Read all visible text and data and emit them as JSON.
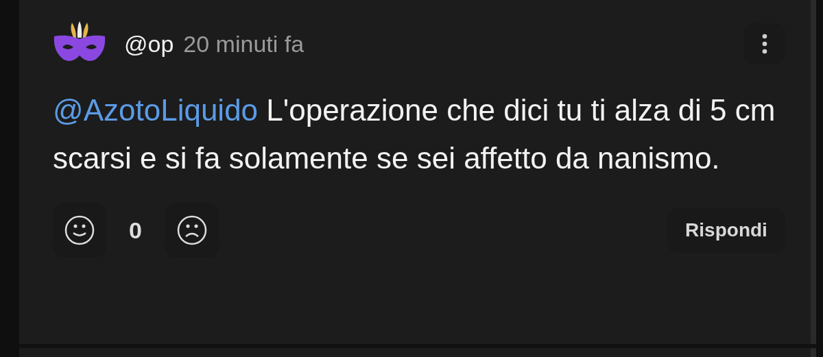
{
  "comment": {
    "author": "@op",
    "time": "20 minuti fa",
    "mention": "@AzotoLiquido",
    "text": " L'operazione che dici tu ti alza di 5 cm scarsi e si fa solamente se sei affetto da nanismo.",
    "score": "0",
    "reply": "Rispondi"
  }
}
